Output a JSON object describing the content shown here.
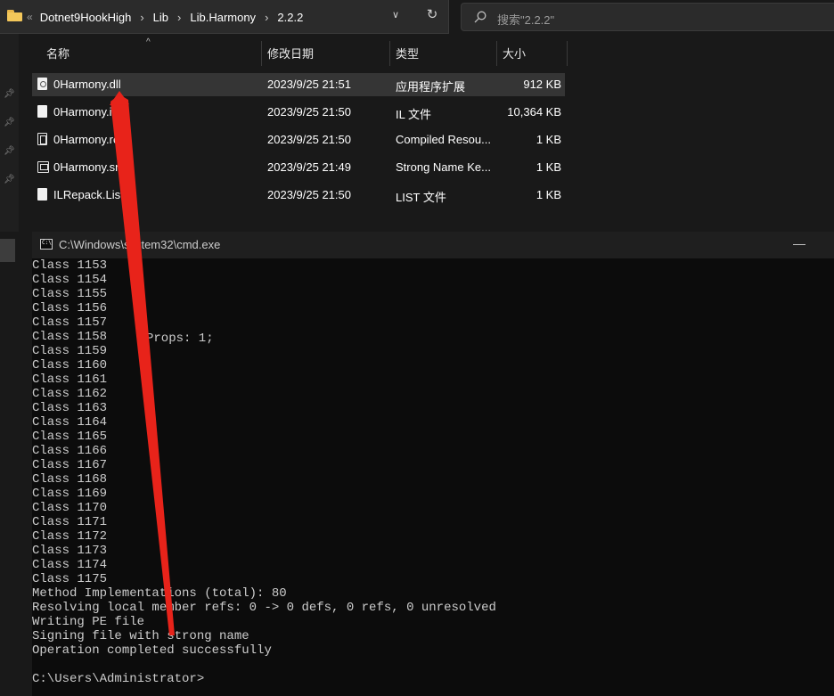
{
  "explorer": {
    "breadcrumb": [
      "Dotnet9HookHigh",
      "Lib",
      "Lib.Harmony",
      "2.2.2"
    ],
    "search_placeholder": "搜索\"2.2.2\"",
    "columns": {
      "name": "名称",
      "date": "修改日期",
      "type": "类型",
      "size": "大小"
    },
    "files": [
      {
        "name": "0Harmony.dll",
        "date": "2023/9/25 21:51",
        "type": "应用程序扩展",
        "size": "912 KB",
        "icon": "dll-file-icon",
        "selected": true
      },
      {
        "name": "0Harmony.il",
        "date": "2023/9/25 21:50",
        "type": "IL 文件",
        "size": "10,364 KB",
        "icon": "file-icon",
        "selected": false
      },
      {
        "name": "0Harmony.re",
        "date": "2023/9/25 21:50",
        "type": "Compiled Resou...",
        "size": "1 KB",
        "icon": "resource-file-icon",
        "selected": false
      },
      {
        "name": "0Harmony.sn",
        "date": "2023/9/25 21:49",
        "type": "Strong Name Ke...",
        "size": "1 KB",
        "icon": "key-file-icon",
        "selected": false
      },
      {
        "name": "ILRepack.List",
        "date": "2023/9/25 21:50",
        "type": "LIST 文件",
        "size": "1 KB",
        "icon": "file-icon",
        "selected": false
      }
    ]
  },
  "cmd": {
    "title": "C:\\Windows\\system32\\cmd.exe",
    "props_text": "Props: 1;",
    "lines": [
      "Class 1153",
      "Class 1154",
      "Class 1155",
      "Class 1156",
      "Class 1157",
      "Class 1158",
      "Class 1159",
      "Class 1160",
      "Class 1161",
      "Class 1162",
      "Class 1163",
      "Class 1164",
      "Class 1165",
      "Class 1166",
      "Class 1167",
      "Class 1168",
      "Class 1169",
      "Class 1170",
      "Class 1171",
      "Class 1172",
      "Class 1173",
      "Class 1174",
      "Class 1175",
      "Method Implementations (total): 80",
      "Resolving local member refs: 0 -> 0 defs, 0 refs, 0 unresolved",
      "Writing PE file",
      "Signing file with strong name",
      "Operation completed successfully",
      "",
      "C:\\Users\\Administrator>"
    ]
  },
  "annotation": {
    "arrow_color": "#e8231a"
  }
}
